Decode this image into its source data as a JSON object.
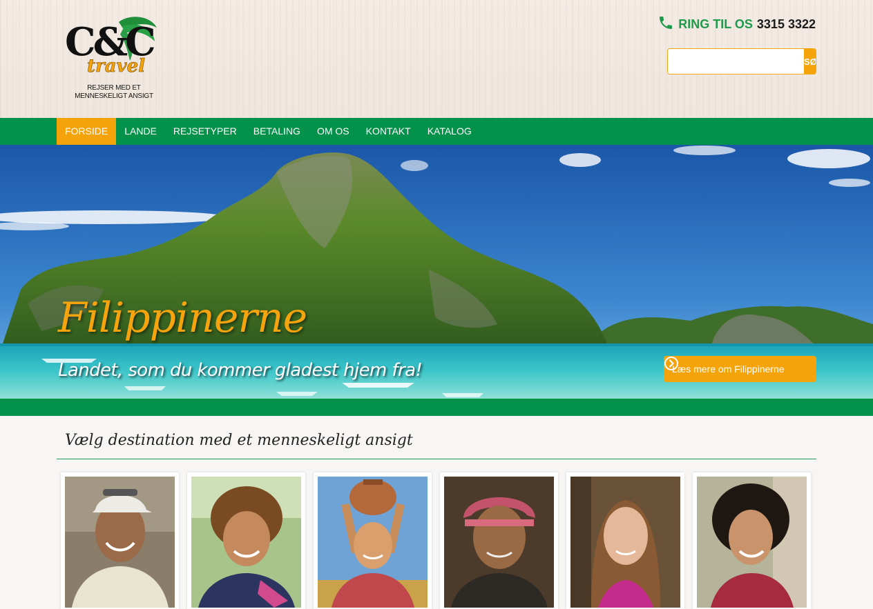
{
  "brand": {
    "logo_name": "C&C",
    "logo_sub": "travel",
    "tagline": "REJSER MED ET MENNESKELIGT ANSIGT",
    "green": "#04924a",
    "orange": "#f5a30b"
  },
  "contact": {
    "label": "RING TIL OS",
    "number": "3315 3322",
    "icon": "phone-icon"
  },
  "search": {
    "placeholder": "",
    "button_label": "SØG"
  },
  "nav": {
    "items": [
      {
        "label": "FORSIDE",
        "active": true
      },
      {
        "label": "LANDE"
      },
      {
        "label": "REJSETYPER"
      },
      {
        "label": "BETALING"
      },
      {
        "label": "OM OS"
      },
      {
        "label": "KONTAKT"
      },
      {
        "label": "KATALOG"
      }
    ]
  },
  "hero": {
    "title": "Filippinerne",
    "subtitle": "Landet, som du kommer gladest hjem fra!",
    "button_label": "Læs mere om Filippinerne",
    "button_icon": "chevron-right-circle-icon"
  },
  "destinations": {
    "heading": "Vælg destination med et menneskeligt ansigt",
    "cards": [
      {
        "icon": "portrait-man-cap"
      },
      {
        "icon": "portrait-boy-curly"
      },
      {
        "icon": "portrait-woman-pot"
      },
      {
        "icon": "portrait-woman-scarf"
      },
      {
        "icon": "portrait-girl"
      },
      {
        "icon": "portrait-girl-curly"
      }
    ]
  }
}
